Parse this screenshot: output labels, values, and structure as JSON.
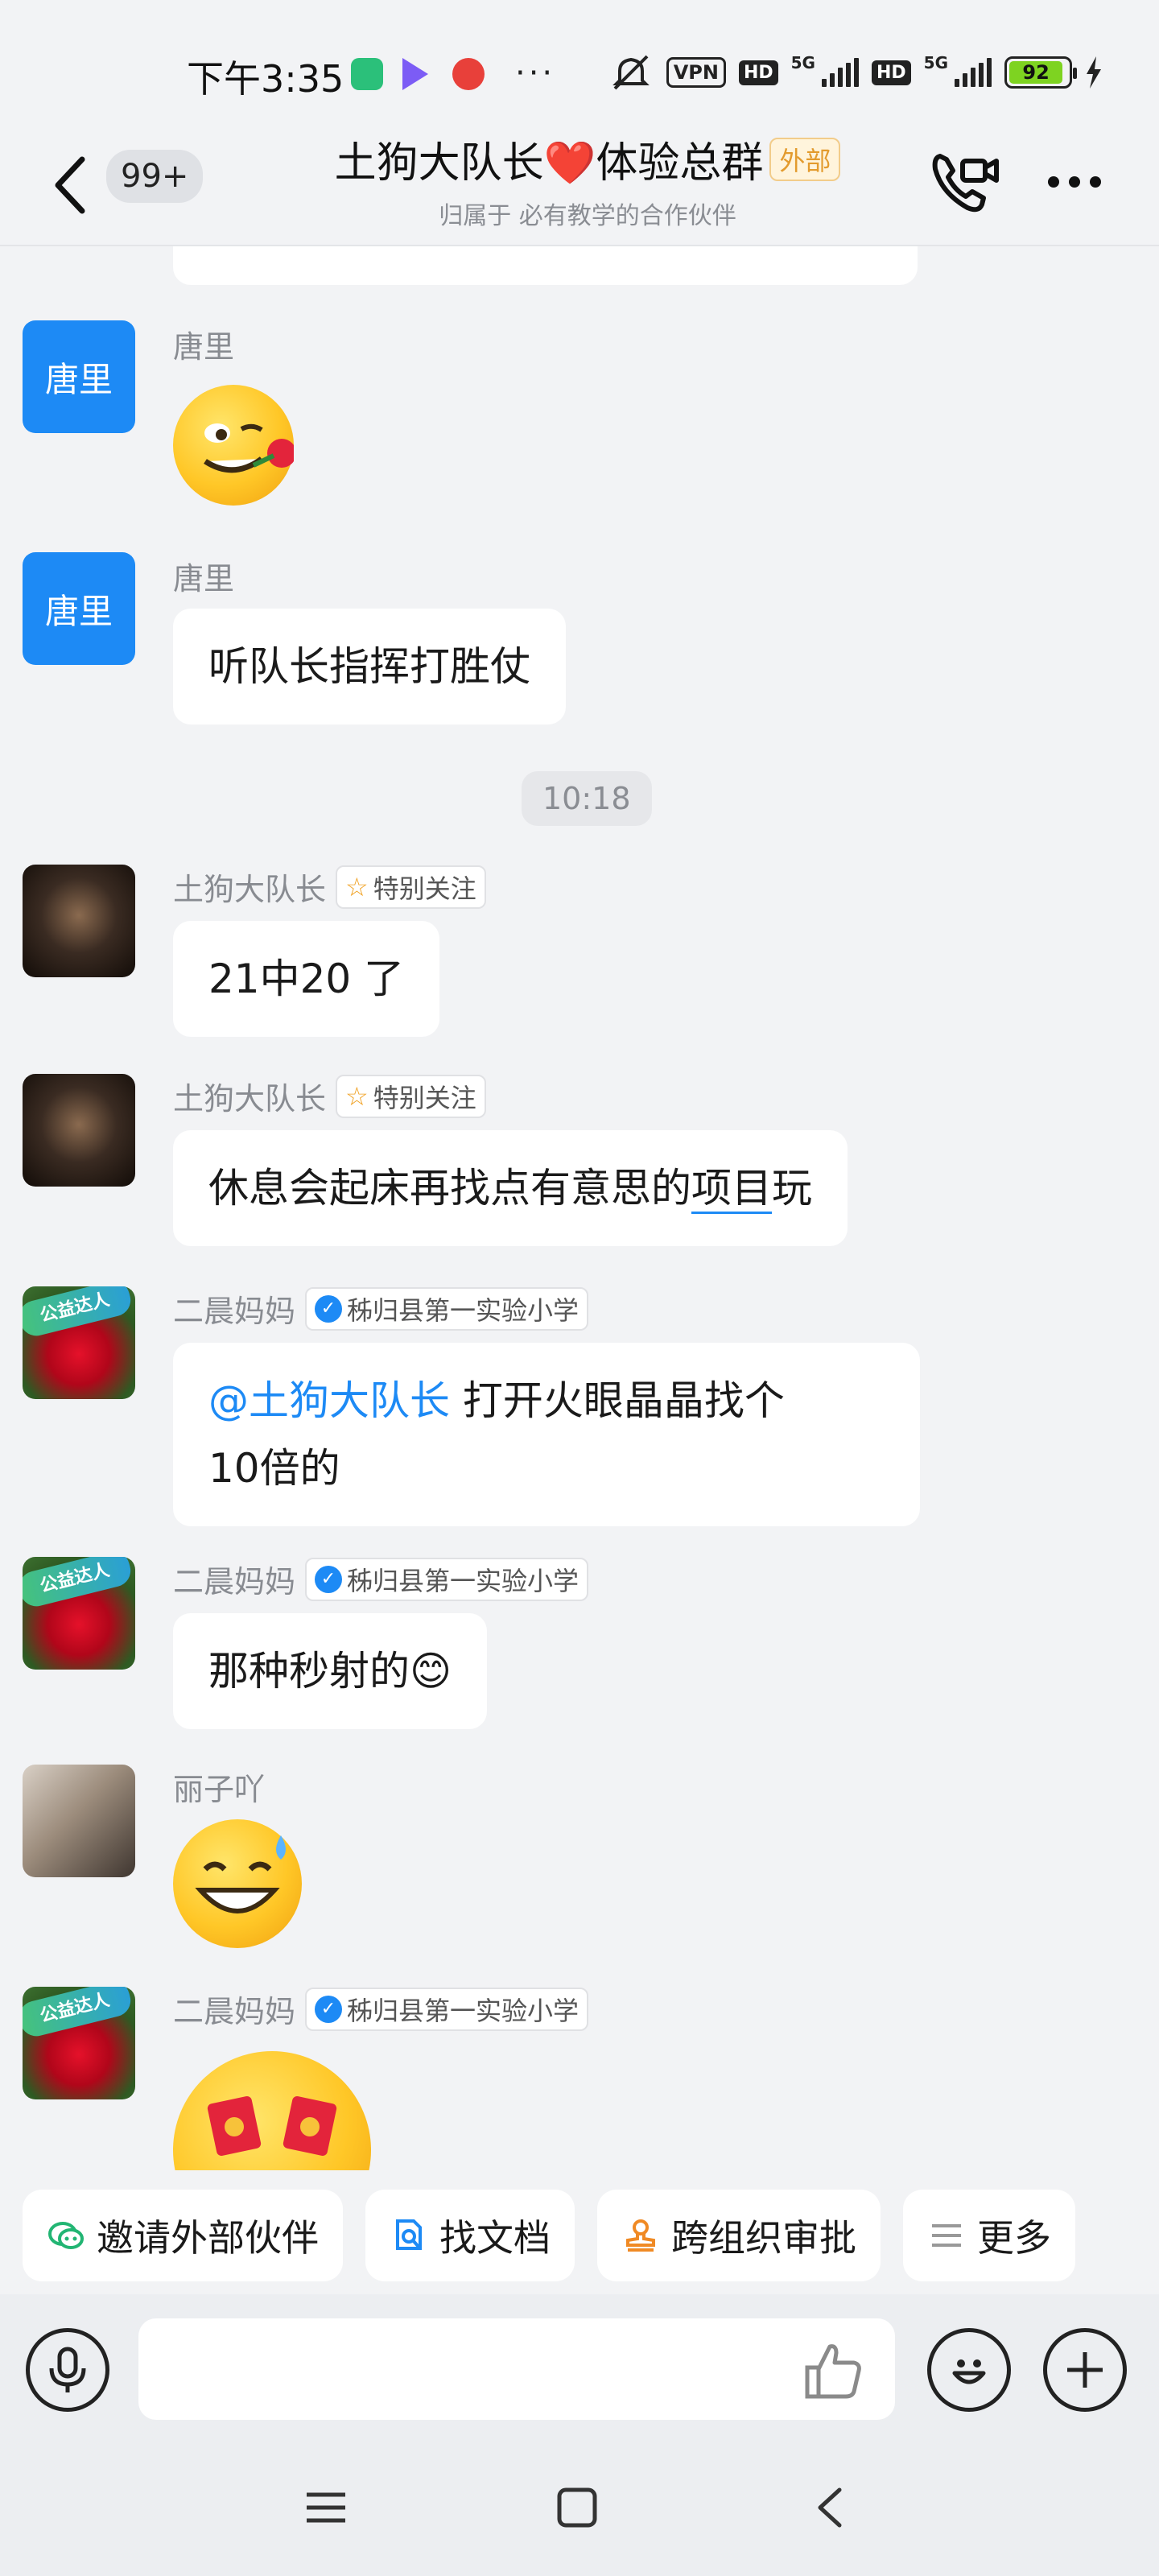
{
  "status_bar": {
    "time": "下午3:35",
    "icons": [
      "shield-app-icon",
      "play-app-icon",
      "weibo-app-icon",
      "more-dots",
      "mute-icon",
      "vpn-icon",
      "hd-icon",
      "5g-signal-icon",
      "battery-icon",
      "charging-icon"
    ],
    "vpn_label": "VPN",
    "hd_label": "HD",
    "net_label": "5G",
    "battery": "92"
  },
  "header": {
    "unread_count": "99+",
    "title": "土狗大队长❤️体验总群",
    "external_tag": "外部",
    "subtitle": "归属于 必有教学的合作伙伴"
  },
  "messages": [
    {
      "sender": "唐里",
      "avatar_text": "唐里",
      "type": "emoji",
      "emoji": "rose-in-mouth-face"
    },
    {
      "sender": "唐里",
      "avatar_text": "唐里",
      "type": "text",
      "text": "听队长指挥打胜仗"
    },
    {
      "sender": "土狗大队长",
      "tag": "特别关注",
      "type": "text",
      "text": "21中20 了"
    },
    {
      "sender": "土狗大队长",
      "tag": "特别关注",
      "type": "text",
      "text_before": "休息会起床再找点有意思的",
      "text_underlined": "项目",
      "text_after": "玩"
    },
    {
      "sender": "二晨妈妈",
      "avatar_badge": "公益达人",
      "tag": "秭归县第一实验小学",
      "type": "text",
      "mention": "@土狗大队长",
      "text_line1": " 打开火眼晶晶找个",
      "text_line2": "10倍的"
    },
    {
      "sender": "二晨妈妈",
      "avatar_badge": "公益达人",
      "tag": "秭归县第一实验小学",
      "type": "text",
      "text": "那种秒射的😊"
    },
    {
      "sender": "丽子吖",
      "type": "emoji",
      "emoji": "grinning-sweat-face"
    },
    {
      "sender": "二晨妈妈",
      "avatar_badge": "公益达人",
      "tag": "秭归县第一实验小学",
      "type": "emoji",
      "emoji": "red-envelope-eyes-face"
    }
  ],
  "timestamp": "10:18",
  "quick_actions": [
    {
      "label": "邀请外部伙伴",
      "icon": "invite-partner-icon"
    },
    {
      "label": "找文档",
      "icon": "find-doc-icon"
    },
    {
      "label": "跨组织审批",
      "icon": "approval-stamp-icon"
    },
    {
      "label": "更多",
      "icon": "menu-lines-icon"
    }
  ],
  "colors": {
    "accent": "#1d8af5",
    "background": "#f2f3f5",
    "bubble": "#ffffff",
    "external_tag": "#e39b2e"
  }
}
